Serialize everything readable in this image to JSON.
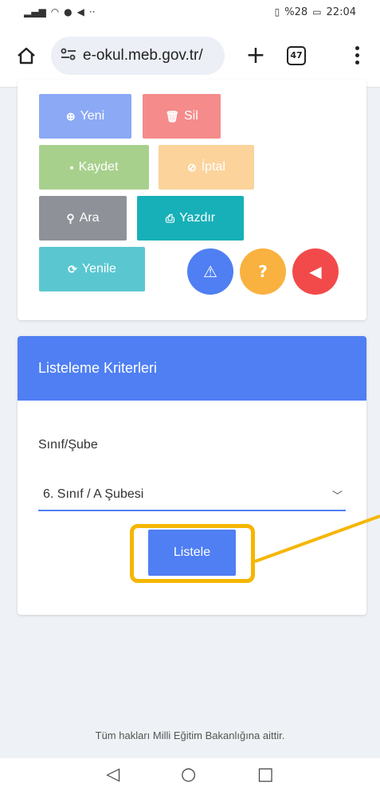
{
  "status_bar": {
    "battery_percent": "%28",
    "time": "22:04"
  },
  "browser": {
    "url": "e-okul.meb.gov.tr/",
    "tab_count": "47"
  },
  "toolbar": {
    "buttons": [
      {
        "label": "Yeni",
        "icon": "plus-circle-icon",
        "color": "#8ba9f5"
      },
      {
        "label": "Sil",
        "icon": "trash-icon",
        "color": "#f58b8b"
      },
      {
        "label": "Kaydet",
        "icon": "save-icon",
        "color": "#a8d08d"
      },
      {
        "label": "İptal",
        "icon": "ban-icon",
        "color": "#fbd39b"
      },
      {
        "label": "Ara",
        "icon": "search-icon",
        "color": "#8e9298"
      },
      {
        "label": "Yazdır",
        "icon": "print-icon",
        "color": "#17b0b8"
      },
      {
        "label": "Yenile",
        "icon": "refresh-icon",
        "color": "#5ac7d0"
      }
    ],
    "circle_buttons": [
      {
        "icon": "warning-icon",
        "color": "#4f7ff3"
      },
      {
        "icon": "help-icon",
        "color": "#f9b23f"
      },
      {
        "icon": "back-icon",
        "color": "#f24a4a"
      }
    ]
  },
  "criteria": {
    "title": "Listeleme Kriterleri",
    "field_label": "Sınıf/Şube",
    "selected_value": "6. Sınıf / A Şubesi",
    "submit_label": "Listele"
  },
  "footer": {
    "text": "Tüm hakları Milli Eğitim Bakanlığına aittir."
  }
}
